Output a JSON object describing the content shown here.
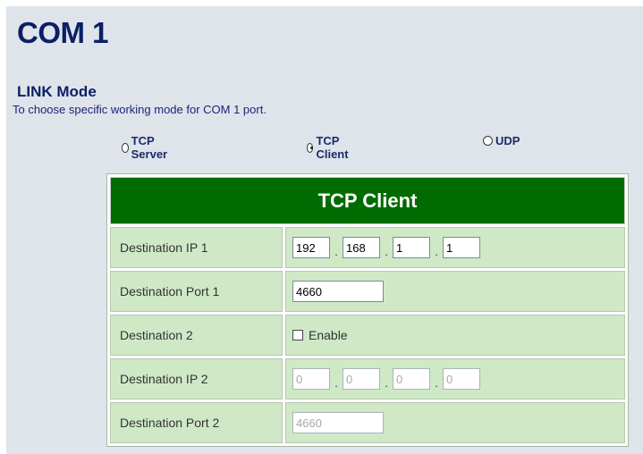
{
  "page": {
    "title": "COM 1"
  },
  "link_mode": {
    "title": "LINK Mode",
    "description": "To choose specific working mode for COM 1 port.",
    "options": [
      {
        "label": "TCP Server",
        "selected": false
      },
      {
        "label": "TCP Client",
        "selected": true
      },
      {
        "label": "UDP",
        "selected": false
      }
    ]
  },
  "config": {
    "header": "TCP Client",
    "dest_ip_1": {
      "label": "Destination IP 1",
      "octets": [
        "192",
        "168",
        "1",
        "1"
      ]
    },
    "dest_port_1": {
      "label": "Destination Port 1",
      "value": "4660"
    },
    "dest_2": {
      "label": "Destination 2",
      "checkbox_label": "Enable",
      "checked": false
    },
    "dest_ip_2": {
      "label": "Destination IP 2",
      "octets": [
        "0",
        "0",
        "0",
        "0"
      ],
      "disabled": true
    },
    "dest_port_2": {
      "label": "Destination Port 2",
      "value": "4660",
      "disabled": true
    }
  },
  "colors": {
    "background": "#dfe4ea",
    "heading": "#0b1f66",
    "table_header": "#006b00",
    "table_cell": "#cfe9c7"
  }
}
